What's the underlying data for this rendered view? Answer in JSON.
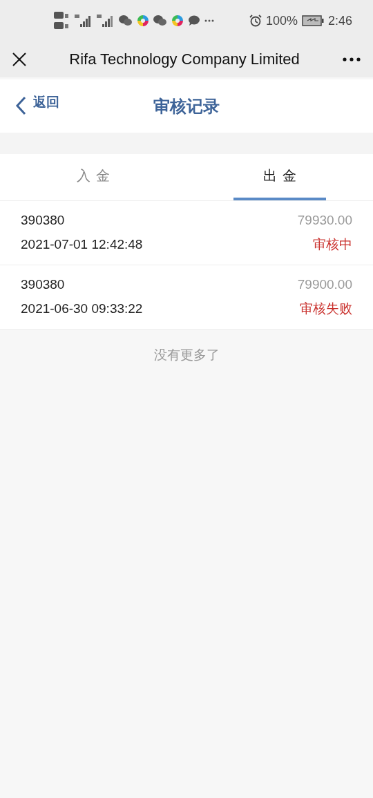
{
  "status_bar": {
    "battery": "100%",
    "time": "2:46"
  },
  "app_bar": {
    "title": "Rifa Technology Company Limited"
  },
  "header": {
    "back": "返回",
    "title": "审核记录"
  },
  "tabs": [
    {
      "label": "入金",
      "selected": false
    },
    {
      "label": "出金",
      "selected": true
    }
  ],
  "records": [
    {
      "account": "390380",
      "amount": "79930.00",
      "time": "2021-07-01 12:42:48",
      "status": "审核中"
    },
    {
      "account": "390380",
      "amount": "79900.00",
      "time": "2021-06-30 09:33:22",
      "status": "审核失败"
    }
  ],
  "footer": "没有更多了"
}
